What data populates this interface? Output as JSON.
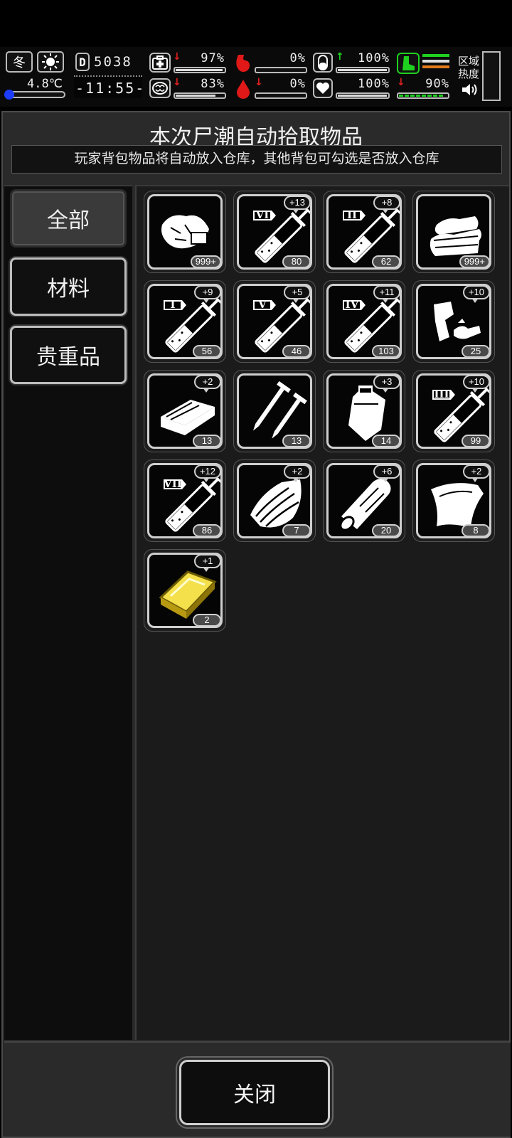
{
  "hud": {
    "season": "冬",
    "temperature": "4.8℃",
    "day": "5038",
    "time": "-11:55-",
    "stats": [
      {
        "name": "health",
        "value": "97%",
        "trend": "down",
        "fill": 0.97
      },
      {
        "name": "hunger",
        "value": "0%",
        "trend": "none",
        "fill": 0.0
      },
      {
        "name": "stamina",
        "value": "100%",
        "trend": "up",
        "fill": 1.0
      },
      {
        "name": "mood",
        "value": "83%",
        "trend": "down",
        "fill": 0.83
      },
      {
        "name": "thirst",
        "value": "0%",
        "trend": "down",
        "fill": 0.0
      },
      {
        "name": "heart",
        "value": "100%",
        "trend": "none",
        "fill": 1.0
      },
      {
        "name": "leg",
        "value": "90%",
        "trend": "down",
        "fill": 0.9
      }
    ],
    "region_heat_label": "区域热度",
    "colors": {
      "red": "#e02020",
      "green": "#1fd11f",
      "orange": "#e07a1a"
    }
  },
  "panel": {
    "title": "本次尸潮自动拾取物品",
    "subtitle": "玩家背包物品将自动放入仓库，其他背包可勾选是否放入仓库"
  },
  "tabs": [
    {
      "label": "全部",
      "active": true
    },
    {
      "label": "材料",
      "active": false
    },
    {
      "label": "贵重品",
      "active": false
    }
  ],
  "items": [
    {
      "icon": "cloth-pile-icon",
      "count": "999+",
      "plus": ""
    },
    {
      "icon": "syringe-vi-icon",
      "roman": "VI",
      "count": "80",
      "plus": "+13"
    },
    {
      "icon": "syringe-ii-icon",
      "roman": "II",
      "count": "62",
      "plus": "+8"
    },
    {
      "icon": "fabric-stack-icon",
      "count": "999+",
      "plus": ""
    },
    {
      "icon": "syringe-i-icon",
      "roman": "I",
      "count": "56",
      "plus": "+9"
    },
    {
      "icon": "syringe-v-icon",
      "roman": "V",
      "count": "46",
      "plus": "+5"
    },
    {
      "icon": "syringe-iv-icon",
      "roman": "IV",
      "count": "103",
      "plus": "+11"
    },
    {
      "icon": "scrap-parts-icon",
      "count": "25",
      "plus": "+10"
    },
    {
      "icon": "wood-plank-icon",
      "count": "13",
      "plus": "+2"
    },
    {
      "icon": "nails-icon",
      "count": "13",
      "plus": ""
    },
    {
      "icon": "plastic-bag-icon",
      "count": "14",
      "plus": "+3"
    },
    {
      "icon": "syringe-iii-icon",
      "roman": "III",
      "count": "99",
      "plus": "+10"
    },
    {
      "icon": "syringe-vii-icon",
      "roman": "VII",
      "count": "86",
      "plus": "+12"
    },
    {
      "icon": "bark-icon",
      "count": "7",
      "plus": "+2"
    },
    {
      "icon": "log-icon",
      "count": "20",
      "plus": "+6"
    },
    {
      "icon": "leather-sheet-icon",
      "count": "8",
      "plus": "+2"
    },
    {
      "icon": "gold-bar-icon",
      "count": "2",
      "plus": "+1"
    }
  ],
  "close_label": "关闭"
}
